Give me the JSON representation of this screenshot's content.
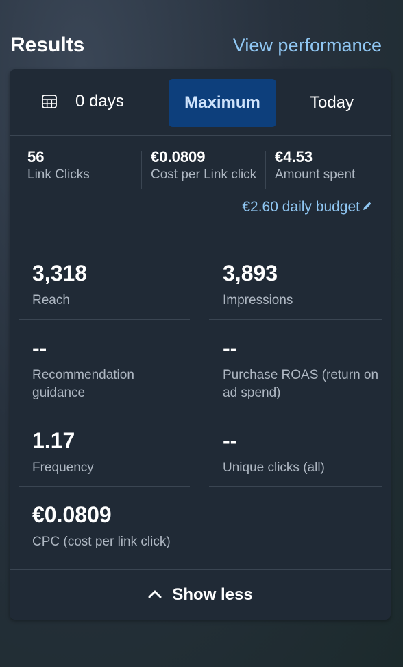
{
  "header": {
    "title": "Results",
    "view_link": "View performance"
  },
  "tabs": {
    "days": "0 days",
    "maximum": "Maximum",
    "today": "Today",
    "calendar_icon": "calendar-grid-icon"
  },
  "summary": [
    {
      "value": "56",
      "label": "Link Clicks"
    },
    {
      "value": "€0.0809",
      "label": "Cost per Link click"
    },
    {
      "value": "€4.53",
      "label": "Amount spent"
    }
  ],
  "budget": {
    "label": "€2.60 daily budget",
    "icon": "pencil-icon"
  },
  "metrics": {
    "reach": {
      "value": "3,318",
      "label": "Reach"
    },
    "impressions": {
      "value": "3,893",
      "label": "Impressions"
    },
    "recommendation": {
      "value": "--",
      "label": "Recommendation guidance"
    },
    "roas": {
      "value": "--",
      "label": "Purchase ROAS (return on ad spend)"
    },
    "frequency": {
      "value": "1.17",
      "label": "Frequency"
    },
    "unique_clicks": {
      "value": "--",
      "label": "Unique clicks (all)"
    },
    "cpc": {
      "value": "€0.0809",
      "label": "CPC (cost per link click)"
    }
  },
  "footer": {
    "show_less": "Show less",
    "icon": "chevron-up-icon"
  },
  "colors": {
    "accent_link": "#8fc6f2",
    "selected_tab": "#0d3f7c",
    "card_bg": "#202a36"
  }
}
